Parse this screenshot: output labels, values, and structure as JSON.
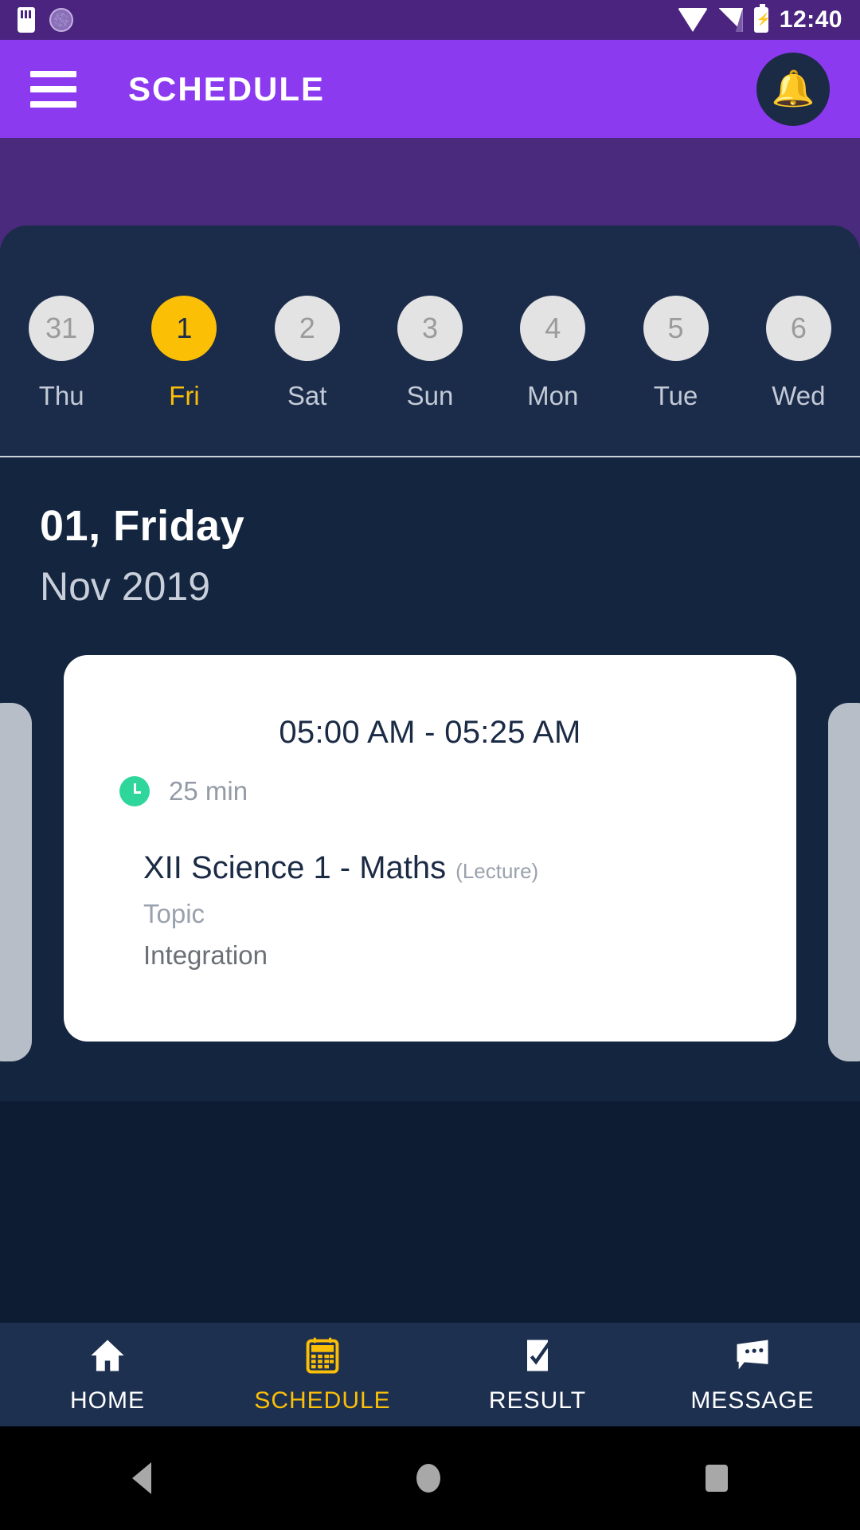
{
  "statusbar": {
    "time": "12:40",
    "icons": [
      "sd-card-icon",
      "dial-icon",
      "wifi-icon",
      "signal-icon",
      "battery-charging-icon"
    ]
  },
  "appbar": {
    "menu_icon": "hamburger-menu-icon",
    "title": "SCHEDULE",
    "notification_icon": "bell-icon",
    "color": "#8B3AF0"
  },
  "date_strip": {
    "days": [
      {
        "num": "31",
        "name": "Thu",
        "selected": false
      },
      {
        "num": "1",
        "name": "Fri",
        "selected": true
      },
      {
        "num": "2",
        "name": "Sat",
        "selected": false
      },
      {
        "num": "3",
        "name": "Sun",
        "selected": false
      },
      {
        "num": "4",
        "name": "Mon",
        "selected": false
      },
      {
        "num": "5",
        "name": "Tue",
        "selected": false
      },
      {
        "num": "6",
        "name": "Wed",
        "selected": false
      }
    ],
    "selected_color": "#FBBF06",
    "card_color": "#1B2B4A"
  },
  "content": {
    "date_main": "01, Friday",
    "date_sub": "Nov 2019"
  },
  "event_card": {
    "time_range": "05:00 AM - 05:25 AM",
    "duration": "25 min",
    "duration_icon": "clock-icon",
    "duration_icon_color": "#2ED69B",
    "subject": "XII Science 1 - Maths",
    "subject_kind": "(Lecture)",
    "topic_label": "Topic",
    "topic_value": "Integration"
  },
  "bottom_nav": {
    "items": [
      {
        "label": "HOME",
        "icon": "home-icon",
        "active": false
      },
      {
        "label": "SCHEDULE",
        "icon": "calendar-icon",
        "active": true
      },
      {
        "label": "RESULT",
        "icon": "result-icon",
        "active": false
      },
      {
        "label": "MESSAGE",
        "icon": "message-icon",
        "active": false
      }
    ],
    "active_color": "#FBBF06"
  },
  "android_nav": {
    "back": "back-triangle-icon",
    "home": "home-circle-icon",
    "recents": "recents-square-icon"
  }
}
